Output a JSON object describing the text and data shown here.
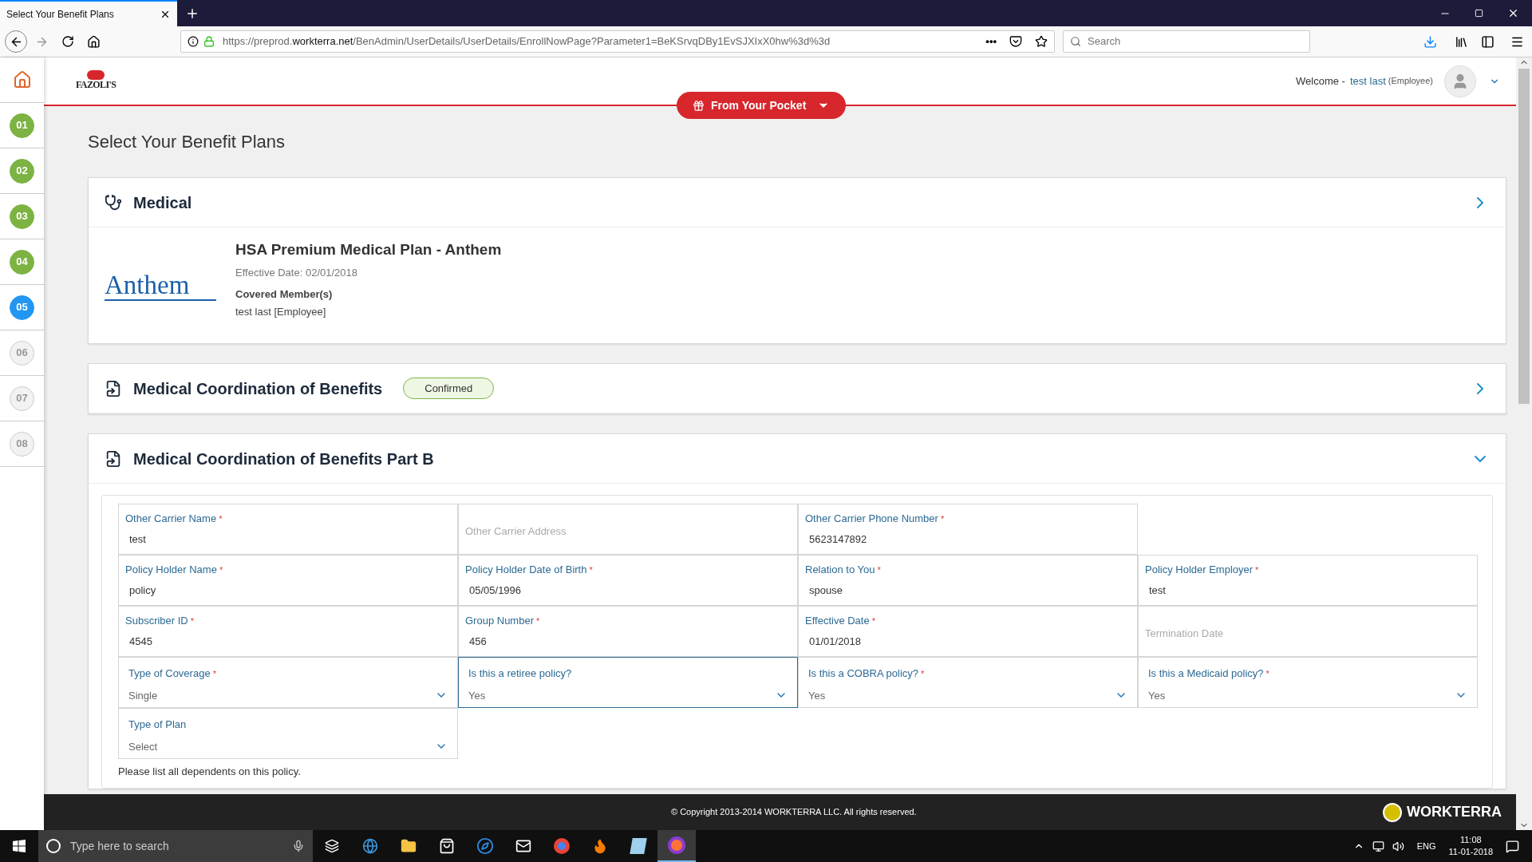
{
  "browser": {
    "tab_title": "Select Your Benefit Plans",
    "url_prefix": "https://preprod.",
    "url_domain": "workterra.net",
    "url_path": "/BenAdmin/UserDetails/UserDetails/EnrollNowPage?Parameter1=BeKSrvqDBy1EvSJXIxX0hw%3d%3d",
    "more": "•••",
    "search_placeholder": "Search"
  },
  "sidebar": {
    "steps": [
      {
        "label": "01",
        "done": true,
        "selected": false
      },
      {
        "label": "02",
        "done": true,
        "selected": false
      },
      {
        "label": "03",
        "done": true,
        "selected": false
      },
      {
        "label": "04",
        "done": true,
        "selected": false
      },
      {
        "label": "05",
        "done": false,
        "selected": true
      },
      {
        "label": "06",
        "done": false,
        "selected": false
      },
      {
        "label": "07",
        "done": false,
        "selected": false
      },
      {
        "label": "08",
        "done": false,
        "selected": false
      }
    ]
  },
  "header": {
    "logo": "FAZOLI'S",
    "pocket_button": "From Your Pocket",
    "welcome": "Welcome -",
    "user_name": "test last",
    "user_role": "(Employee)"
  },
  "page_title": "Select Your Benefit Plans",
  "sections": [
    {
      "kind": "medical",
      "title": "Medical",
      "expanded": false,
      "plan": {
        "carrier_logo": "Anthem",
        "name": "HSA Premium Medical Plan - Anthem",
        "effective": "Effective Date: 02/01/2018",
        "members_label": "Covered Member(s)",
        "members": "test last [Employee]"
      }
    },
    {
      "kind": "document",
      "title": "Medical Coordination of Benefits",
      "expanded": false,
      "badge": "Confirmed"
    },
    {
      "kind": "document",
      "title": "Medical Coordination of Benefits Part B",
      "expanded": true
    }
  ],
  "form": {
    "rows": [
      [
        {
          "kind": "text",
          "label": "Other Carrier Name",
          "required_mark": "*",
          "value": "test"
        },
        {
          "kind": "text",
          "placeholder": "Other Carrier Address"
        },
        {
          "kind": "text",
          "label": "Other Carrier Phone Number",
          "required_mark": "*",
          "value": "5623147892"
        }
      ],
      [
        {
          "kind": "text",
          "label": "Policy Holder Name",
          "required_mark": "*",
          "value": "policy"
        },
        {
          "kind": "text",
          "label": "Policy Holder Date of Birth",
          "required_mark": "*",
          "value": "05/05/1996"
        },
        {
          "kind": "text",
          "label": "Relation to You",
          "required_mark": "*",
          "value": "spouse"
        },
        {
          "kind": "text",
          "label": "Policy Holder Employer",
          "required_mark": "*",
          "value": "test"
        }
      ],
      [
        {
          "kind": "text",
          "label": "Subscriber ID",
          "required_mark": "*",
          "value": "4545"
        },
        {
          "kind": "text",
          "label": "Group Number",
          "required_mark": "*",
          "value": "456"
        },
        {
          "kind": "text",
          "label": "Effective Date",
          "required_mark": "*",
          "value": "01/01/2018"
        },
        {
          "kind": "text",
          "placeholder": "Termination Date"
        }
      ],
      [
        {
          "kind": "select",
          "label": "Type of Coverage",
          "required_mark": "*",
          "value": "Single",
          "focused": false
        },
        {
          "kind": "select",
          "label": "Is this a retiree policy?",
          "value": "Yes",
          "focused": true
        },
        {
          "kind": "select",
          "label": "Is this a COBRA policy?",
          "required_mark": "*",
          "value": "Yes",
          "focused": false
        },
        {
          "kind": "select",
          "label": "Is this a Medicaid policy?",
          "required_mark": "*",
          "value": "Yes",
          "focused": false
        }
      ],
      [
        {
          "kind": "select",
          "label": "Type of Plan",
          "value": "Select",
          "focused": false
        }
      ]
    ],
    "note": "Please list all dependents on this policy."
  },
  "footer": {
    "copyright": "© Copyright 2013-2014 WORKTERRA LLC. All rights reserved.",
    "brand": "WORKTERRA"
  },
  "taskbar": {
    "search_placeholder": "Type here to search",
    "language": "ENG",
    "time": "11:08",
    "date": "11-01-2018"
  }
}
